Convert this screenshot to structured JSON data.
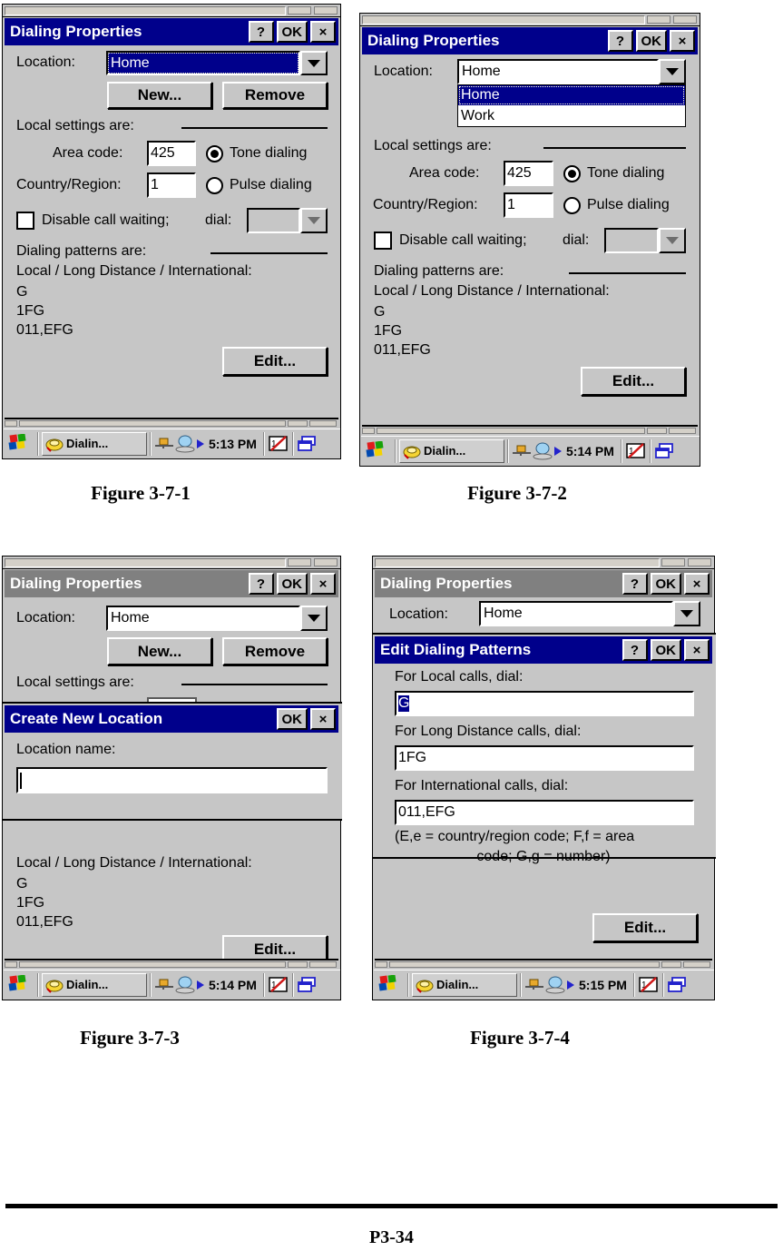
{
  "page": {
    "footer_page_number": "P3-34"
  },
  "colors": {
    "title_active": "#00008b",
    "title_inactive": "#808080",
    "dialog_face": "#c6c6c6",
    "field_bg": "#ffffff",
    "selection": "#00008b"
  },
  "common": {
    "titlebar_help": "?",
    "titlebar_ok": "OK",
    "titlebar_close": "×",
    "dialing_properties_title": "Dialing Properties",
    "location_label": "Location:",
    "new_button": "New...",
    "remove_button": "Remove",
    "local_settings_label": "Local settings are:",
    "area_code_label": "Area code:",
    "country_region_label": "Country/Region:",
    "tone_dialing_label": "Tone dialing",
    "pulse_dialing_label": "Pulse dialing",
    "disable_call_waiting_label": "Disable call waiting;",
    "dial_label": "dial:",
    "dialing_patterns_label": "Dialing patterns are:",
    "patterns_header": "Local / Long Distance / International:",
    "pattern_local": "G",
    "pattern_long_distance": "1FG",
    "pattern_international": "011,EFG",
    "edit_button": "Edit...",
    "area_code_value": "425",
    "country_region_value": "1",
    "dial_value": "",
    "location_value": "Home",
    "taskbar_app_label": "Dialin...",
    "start_icon": "windows-flag-icon",
    "app_icon": "dialing-phone-icon",
    "network_icon": "network-connection-icon",
    "arrow_icon": "play-arrow-icon",
    "notepad_icon": "notes-icon",
    "desktop_icon": "show-desktop-icon"
  },
  "figures": [
    {
      "id": "fig-3-7-1",
      "caption": "Figure 3-7-1",
      "title": "Dialing Properties",
      "title_state": "active",
      "location_focused": true,
      "dropdown_open": false,
      "clock": "5:13 PM"
    },
    {
      "id": "fig-3-7-2",
      "caption": "Figure 3-7-2",
      "title": "Dialing Properties",
      "title_state": "active",
      "location_focused": false,
      "dropdown_open": true,
      "dropdown_options": [
        {
          "label": "Home",
          "selected": true
        },
        {
          "label": "Work",
          "selected": false
        }
      ],
      "clock": "5:14 PM"
    },
    {
      "id": "fig-3-7-3",
      "caption": "Figure 3-7-3",
      "title": "Dialing Properties",
      "title_state": "inactive",
      "clock": "5:14 PM",
      "overlay": {
        "title": "Create New Location",
        "title_state": "active",
        "ok_label": "OK",
        "close_label": "×",
        "location_name_label": "Location name:",
        "location_name_value": ""
      }
    },
    {
      "id": "fig-3-7-4",
      "caption": "Figure 3-7-4",
      "title": "Dialing Properties",
      "title_state": "inactive",
      "clock": "5:15 PM",
      "overlay": {
        "title": "Edit Dialing Patterns",
        "title_state": "active",
        "help_label": "?",
        "ok_label": "OK",
        "close_label": "×",
        "local_label": "For Local calls, dial:",
        "local_value": "G",
        "local_value_selected": true,
        "long_distance_label": "For Long Distance calls, dial:",
        "long_distance_value": "1FG",
        "international_label": "For International calls, dial:",
        "international_value": "011,EFG",
        "hint_line1": "(E,e = country/region code; F,f = area",
        "hint_line2": "code; G,g = number)",
        "edit_button": "Edit..."
      }
    }
  ]
}
